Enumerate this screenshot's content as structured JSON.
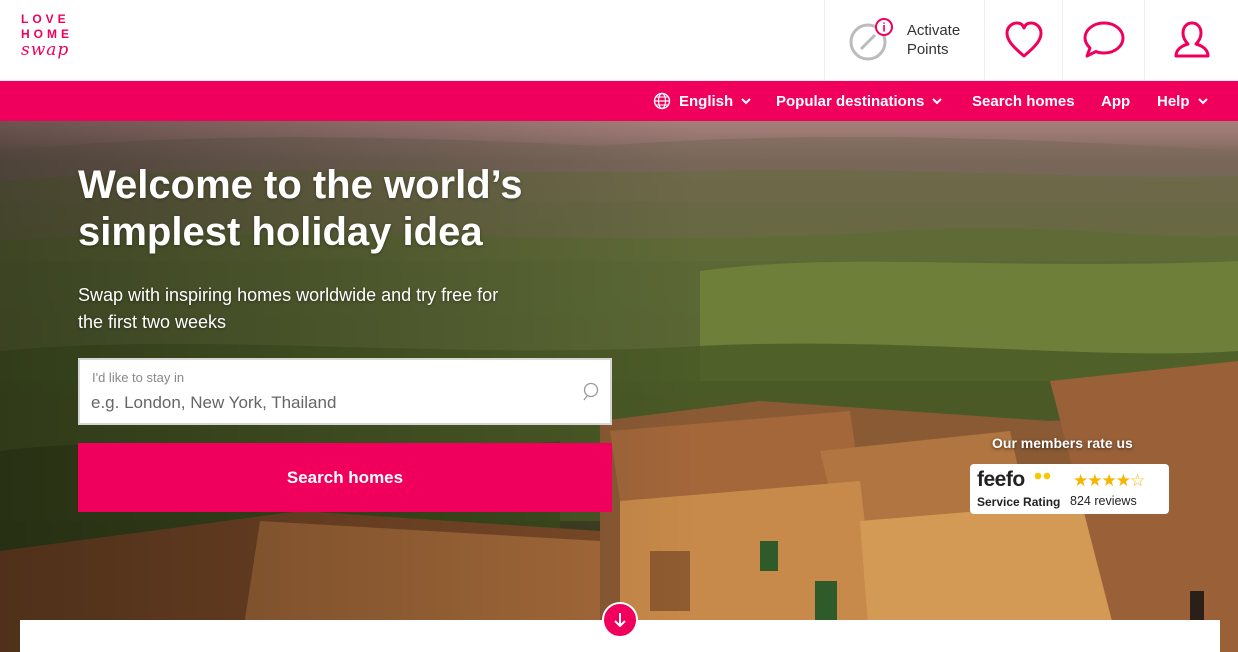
{
  "logo": {
    "line1": "LOVE",
    "line2": "HOME",
    "line3": "swap"
  },
  "header": {
    "activate_label": "Activate",
    "points_label": "Points",
    "icons": [
      "activate-points-icon",
      "heart-icon",
      "chat-bubble-icon",
      "user-icon"
    ]
  },
  "nav": {
    "language": "English",
    "popular": "Popular destinations",
    "search": "Search homes",
    "app": "App",
    "help": "Help"
  },
  "hero": {
    "headline_line1": "Welcome to the world’s",
    "headline_line2": "simplest holiday idea",
    "subline_line1": "Swap with inspiring homes worldwide and try free for",
    "subline_line2": "the first two weeks",
    "search_label": "I'd like to stay in",
    "search_placeholder": "e.g. London, New York, Thailand",
    "search_button": "Search homes"
  },
  "rating": {
    "title": "Our members rate us",
    "brand": "feefo",
    "service": "Service Rating",
    "stars": "★★★★☆",
    "reviews": "824 reviews"
  },
  "colors": {
    "brand": "#f0005c",
    "star": "#f7b500"
  }
}
